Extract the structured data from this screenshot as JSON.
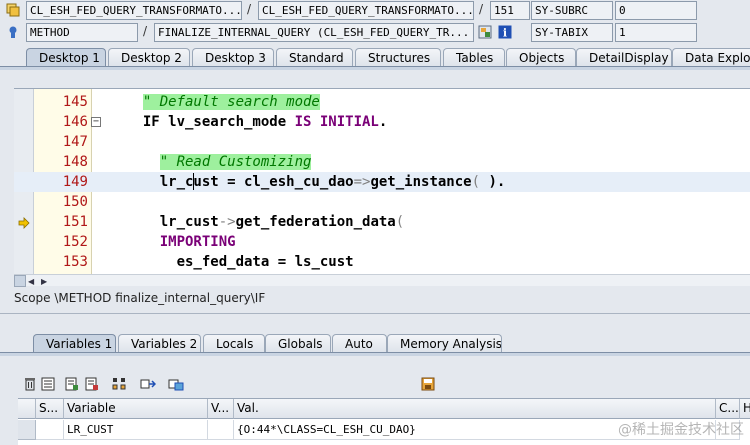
{
  "header": {
    "row1": {
      "program": "CL_ESH_FED_QUERY_TRANSFORMATO...",
      "include": "CL_ESH_FED_QUERY_TRANSFORMATO...",
      "line": "151",
      "sysvar": "SY-SUBRC",
      "sysval": "0"
    },
    "row2": {
      "event_type": "METHOD",
      "event": "FINALIZE_INTERNAL_QUERY (CL_ESH_FED_QUERY_TR...",
      "sysvar": "SY-TABIX",
      "sysval": "1"
    },
    "sep": "/"
  },
  "main_tabs": [
    "Desktop 1",
    "Desktop 2",
    "Desktop 3",
    "Standard",
    "Structures",
    "Tables",
    "Objects",
    "DetailDisplay",
    "Data Explore"
  ],
  "editor": {
    "lines": [
      {
        "num": "145",
        "segments": [
          {
            "t": "  ",
            "c": ""
          },
          {
            "t": "\" Default search mode",
            "c": "cm"
          }
        ]
      },
      {
        "num": "146",
        "segments": [
          {
            "t": "  ",
            "c": ""
          },
          {
            "t": "IF lv_search_mode ",
            "c": "kwb"
          },
          {
            "t": "IS INITIAL",
            "c": "kw"
          },
          {
            "t": ".",
            "c": "kwb"
          }
        ]
      },
      {
        "num": "147",
        "segments": []
      },
      {
        "num": "148",
        "segments": [
          {
            "t": "    ",
            "c": ""
          },
          {
            "t": "\" Read Customizing",
            "c": "cm"
          }
        ]
      },
      {
        "num": "149",
        "segments": [
          {
            "t": "    ",
            "c": ""
          },
          {
            "t": "lr_cust = cl_esh_cu_dao",
            "c": "kwb"
          },
          {
            "t": "=>",
            "c": "op"
          },
          {
            "t": "get_instance",
            "c": "kwb"
          },
          {
            "t": "( ",
            "c": "op"
          },
          {
            "t": ").",
            "c": "kwb"
          }
        ]
      },
      {
        "num": "150",
        "segments": []
      },
      {
        "num": "151",
        "segments": [
          {
            "t": "    ",
            "c": ""
          },
          {
            "t": "lr_cust",
            "c": "kwb"
          },
          {
            "t": "->",
            "c": "op"
          },
          {
            "t": "get_federation_data",
            "c": "kwb"
          },
          {
            "t": "(",
            "c": "op"
          }
        ]
      },
      {
        "num": "152",
        "segments": [
          {
            "t": "    ",
            "c": ""
          },
          {
            "t": "IMPORTING",
            "c": "kw"
          }
        ]
      },
      {
        "num": "153",
        "segments": [
          {
            "t": "      ",
            "c": ""
          },
          {
            "t": "es_fed_data = ls_cust",
            "c": "kwb"
          }
        ]
      }
    ]
  },
  "scope": "Scope \\METHOD finalize_internal_query\\IF",
  "var_tabs": [
    "Variables 1",
    "Variables 2",
    "Locals",
    "Globals",
    "Auto",
    "Memory Analysis"
  ],
  "grid": {
    "headers": [
      "S...",
      "Variable",
      "V...",
      "Val.",
      "C...",
      "He"
    ],
    "rows": [
      {
        "variable": "LR_CUST",
        "value": "{O:44*\\CLASS=CL_ESH_CU_DAO}"
      }
    ]
  },
  "watermark": "@稀土掘金技术社区",
  "colors": {
    "accent": "#c9d4e2",
    "line_number": "#b01717",
    "keyword": "#7a0077",
    "comment_bg": "#9ef09e",
    "comment_fg": "#007800"
  }
}
